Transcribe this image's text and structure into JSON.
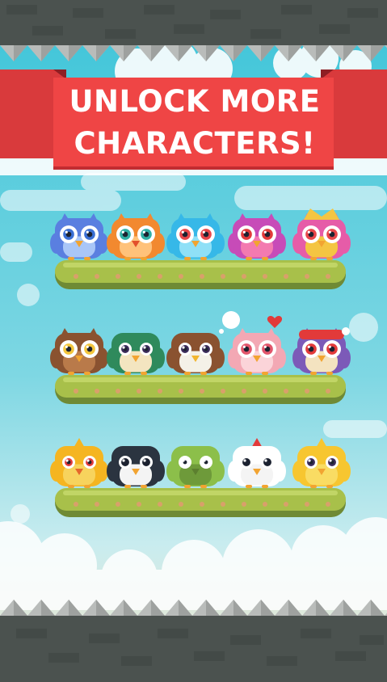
{
  "banner": {
    "line1": "UNLOCK MORE",
    "line2": "CHARACTERS!"
  },
  "colors": {
    "sky_top": "#3ec6d9",
    "sky_bottom": "#c6ecef",
    "banner_red": "#ef4545",
    "banner_shadow": "#c22c31",
    "grass": "#a8c04a",
    "wall_dark": "#4b524f",
    "spike_gray": "#b9bcba"
  },
  "shelves": [
    {
      "characters": [
        {
          "name": "blue-owl",
          "kind": "owl",
          "body": "#5a7fe0",
          "belly": "#a9c6f7",
          "eye": "#3a6fd4",
          "beak": "#f2a431"
        },
        {
          "name": "orange-owl",
          "kind": "owl",
          "body": "#f2892f",
          "belly": "#ffc27a",
          "eye": "#2fb0a5",
          "beak": "#e3502b"
        },
        {
          "name": "cyan-owl",
          "kind": "owl",
          "body": "#36b8e8",
          "belly": "#8fe0f7",
          "eye": "#e8464a",
          "beak": "#f2a431"
        },
        {
          "name": "purple-owl",
          "kind": "owl",
          "body": "#c74bb8",
          "belly": "#f37ab0",
          "eye": "#e23a3a",
          "beak": "#f2a431"
        },
        {
          "name": "jeweled-owl",
          "kind": "owl",
          "body": "#e65ca8",
          "belly": "#f4c542",
          "eye": "#e8464a",
          "beak": "#f2a431",
          "crown": true
        }
      ]
    },
    {
      "characters": [
        {
          "name": "brown-owl",
          "kind": "owl",
          "body": "#8a5230",
          "belly": "#b97a4a",
          "eye": "#f2c53c",
          "beak": "#f2a431"
        },
        {
          "name": "duck",
          "kind": "duck",
          "body": "#2f8a5c",
          "belly": "#f3e5c0",
          "eye": "#3b2c5a",
          "beak": "#f2a431"
        },
        {
          "name": "eagle",
          "kind": "eagle",
          "body": "#8a5230",
          "belly": "#f4f1e8",
          "eye": "#3b2c5a",
          "beak": "#f2b630",
          "bubble": true
        },
        {
          "name": "pink-owl",
          "kind": "owl",
          "body": "#f3a8b4",
          "belly": "#fbd4d9",
          "eye": "#e2566c",
          "beak": "#f2a431",
          "heart": true
        },
        {
          "name": "santa-owl",
          "kind": "owl",
          "body": "#7c5ab8",
          "belly": "#f4e3c0",
          "eye": "#e23a3a",
          "beak": "#f2a431",
          "hat": true
        }
      ]
    },
    {
      "characters": [
        {
          "name": "phoenix",
          "kind": "bird",
          "body": "#f5b521",
          "belly": "#f7d35d",
          "eye": "#e23a3a",
          "beak": "#e5672b"
        },
        {
          "name": "penguin",
          "kind": "penguin",
          "body": "#2b3440",
          "belly": "#f4f4f4",
          "eye": "#1c2230",
          "beak": "#f2a431"
        },
        {
          "name": "frankenstein",
          "kind": "monster",
          "body": "#8cbf4a",
          "belly": "#6e9a3a",
          "eye": "#ffffff",
          "beak": "#5c7f2f"
        },
        {
          "name": "chicken",
          "kind": "chicken",
          "body": "#ffffff",
          "belly": "#f4f4f4",
          "eye": "#1c2230",
          "beak": "#f2a431"
        },
        {
          "name": "chick",
          "kind": "bird",
          "body": "#f7c630",
          "belly": "#f9dc63",
          "eye": "#3b2c5a",
          "beak": "#f2a431"
        }
      ]
    }
  ]
}
